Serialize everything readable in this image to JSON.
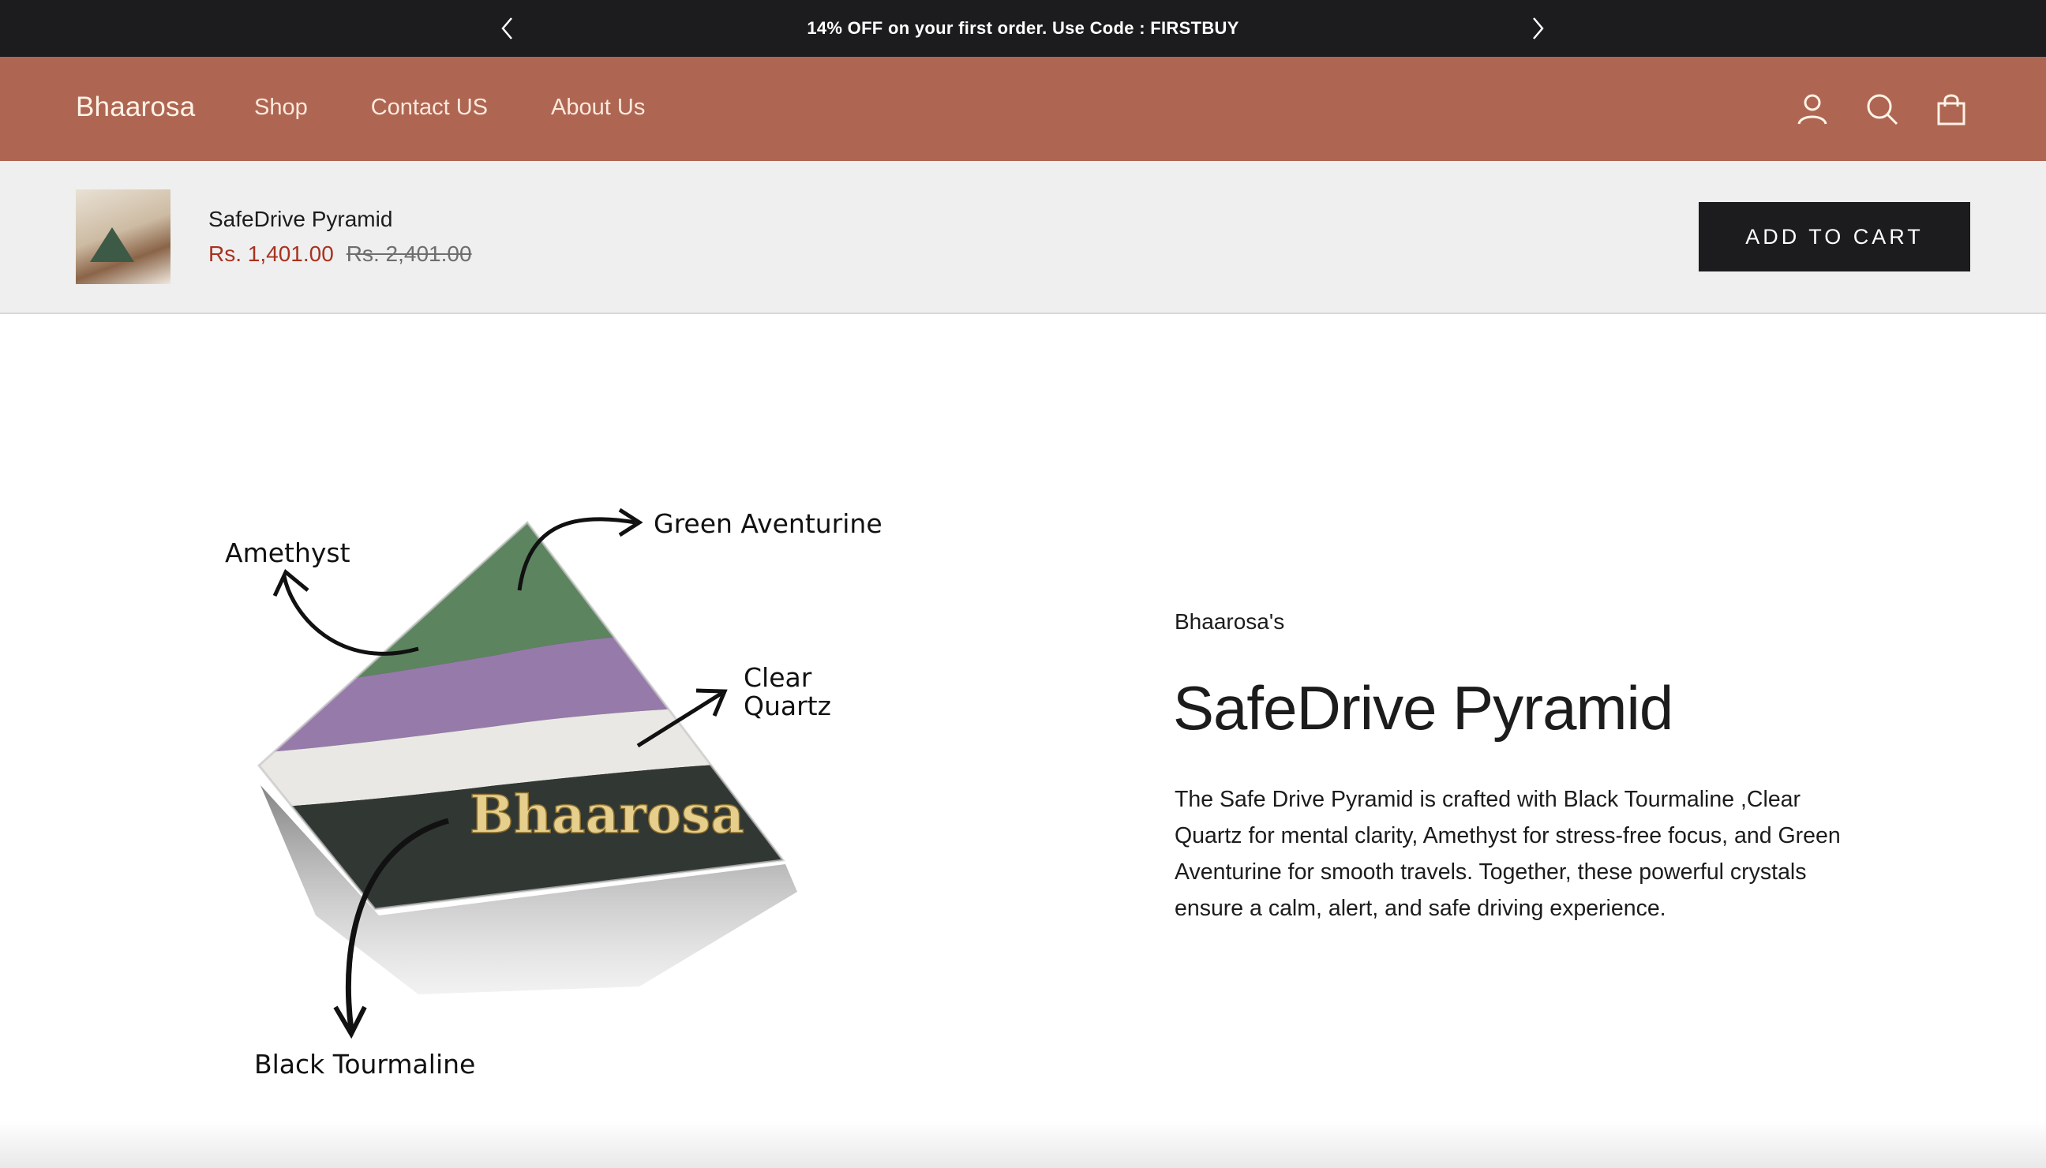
{
  "announcement": {
    "text": "14% OFF on your first order. Use Code : FIRSTBUY",
    "prev_icon": "chevron-left-icon",
    "next_icon": "chevron-right-icon"
  },
  "header": {
    "logo": "Bhaarosa",
    "nav": [
      "Shop",
      "Contact US",
      "About Us"
    ],
    "icons": [
      "account-icon",
      "search-icon",
      "cart-bag-icon"
    ],
    "background": "#ae6653"
  },
  "sticky_bar": {
    "product_title": "SafeDrive Pyramid",
    "sale_price": "Rs. 1,401.00",
    "original_price": "Rs. 2,401.00",
    "add_to_cart_label": "ADD TO CART"
  },
  "product": {
    "vendor": "Bhaarosa's",
    "title": "SafeDrive Pyramid",
    "description": "The Safe Drive Pyramid is crafted with Black Tourmaline ,Clear Quartz for mental clarity, Amethyst for stress-free focus, and Green Aventurine for smooth travels. Together, these powerful crystals ensure a calm, alert, and safe driving experience.",
    "image_labels": {
      "amethyst": "Amethyst",
      "green_aventurine": "Green Aventurine",
      "clear": "Clear",
      "quartz": "Quartz",
      "black_tourmaline": "Black Tourmaline",
      "engraving": "Bhaarosa"
    }
  }
}
